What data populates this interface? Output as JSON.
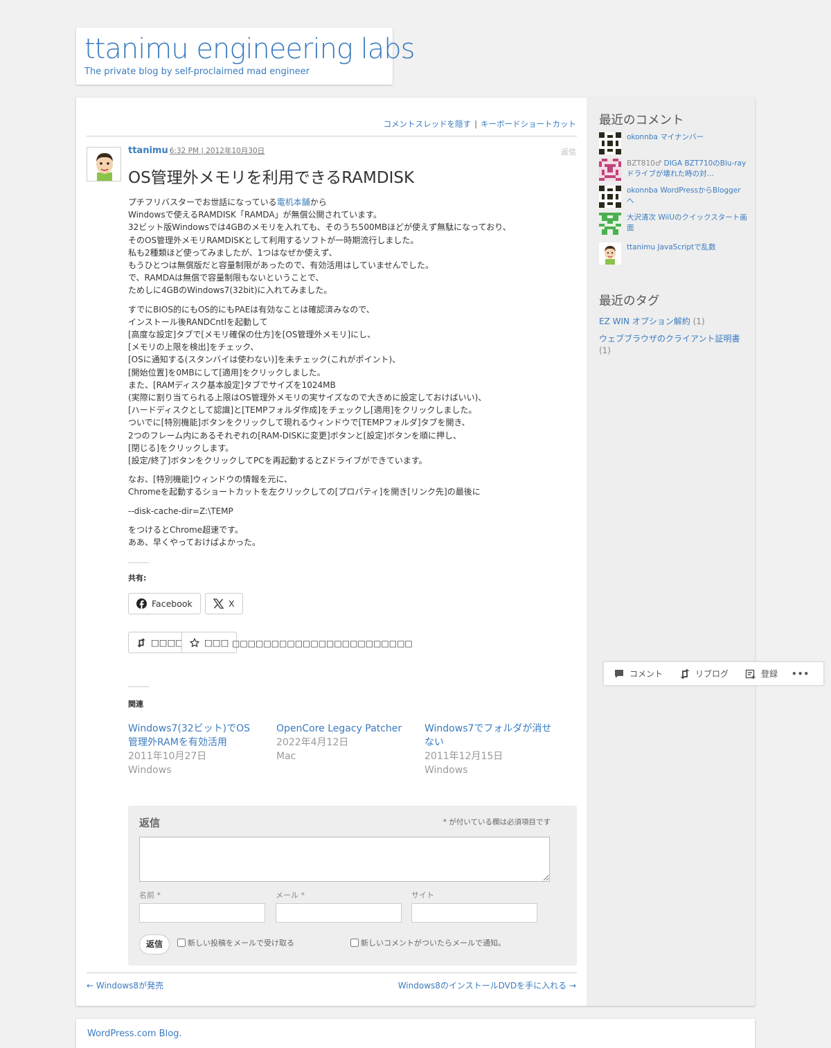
{
  "site": {
    "title": "ttanimu engineering labs",
    "tagline": "The private blog by self-proclaimed mad engineer"
  },
  "thread_links": {
    "hide": "コメントスレッドを隠す",
    "separator": "|",
    "shortcuts": "キーボードショートカット"
  },
  "post": {
    "author": "ttanimu",
    "datetime": "6:32 PM | 2012年10月30日",
    "reply": "返信",
    "title": "OS管理外メモリを利用できるRAMDISK",
    "p1_pre": "プチフリバスターでお世話になっている",
    "p1_link": "電机本舗",
    "p1_post": "から\nWindowsで使えるRAMDISK「RAMDA」が無償公開されています。\n32ビット版Windowsでは4GBのメモリを入れても、そのうち500MBほどが使えず無駄になっており、\nそのOS管理外メモリRAMDISKとして利用するソフトが一時期流行しました。\n私も2種類ほど使ってみましたが、1つはなぜか使えず、\nもうひとつは無償版だと容量制限があったので、有効活用はしていませんでした。\nで、RAMDAは無償で容量制限もないということで、\nためしに4GBのWindows7(32bit)に入れてみました。",
    "p2": "すでにBIOS的にもOS的にもPAEは有効なことは確認済みなので、\nインストール後RANDCntlを起動して\n[高度な設定]タブで[メモリ確保の仕方]を[OS管理外メモリ]にし、\n[メモリの上限を検出]をチェック、\n[OSに通知する(スタンバイは使わない)]を未チェック(これがポイント)、\n[開始位置]を0MBにして[適用]をクリックしました。\nまた、[RAMディスク基本設定]タブでサイズを1024MB\n(実際に割り当てられる上限はOS管理外メモリの実サイズなので大きめに設定しておけばいい)、\n[ハードディスクとして認識]と[TEMPフォルダ作成]をチェックし[適用]をクリックしました。\nついでに[特別機能]ボタンをクリックして現れるウィンドウで[TEMPフォルダ]タブを開き、\n2つのフレーム内にあるそれぞれの[RAM-DISKに変更]ボタンと[設定]ボタンを順に押し、\n[閉じる]をクリックします。\n[設定/終了]ボタンをクリックしてPCを再起動するとZドライブができています。",
    "p3": "なお、[特別機能]ウィンドウの情報を元に、\nChromeを起動するショートカットを左クリックしての[プロパティ]を開き[リンク先]の最後に",
    "p4": "--disk-cache-dir=Z:\\TEMP",
    "p5": "をつけるとChrome超速です。\nああ、早くやっておけばよかった。"
  },
  "share": {
    "label": "共有:",
    "facebook": "Facebook",
    "x": "X"
  },
  "like": {
    "reblog": "□□□□",
    "like": "□□□",
    "text": "□□□□□□□□□□□□□□□□□□□□□□□"
  },
  "related": {
    "label": "関連",
    "items": [
      {
        "title": "Windows7(32ビット)でOS管理外RAMを有効活用",
        "date": "2011年10月27日",
        "cat": "Windows"
      },
      {
        "title": "OpenCore Legacy Patcher",
        "date": "2022年4月12日",
        "cat": "Mac"
      },
      {
        "title": "Windows7でフォルダが消せない",
        "date": "2011年12月15日",
        "cat": "Windows"
      }
    ]
  },
  "form": {
    "heading": "返信",
    "required_note": "* が付いている欄は必須項目です",
    "name_label": "名前 *",
    "email_label": "メール *",
    "site_label": "サイト",
    "submit": "返信",
    "chk_posts": "新しい投稿をメールで受け取る",
    "chk_comments": "新しいコメントがついたらメールで通知。"
  },
  "nav": {
    "prev": "← Windows8が発売",
    "next": "Windows8のインストールDVDを手に入れる →"
  },
  "sidebar": {
    "recent_comments_title": "最近のコメント",
    "comments": [
      {
        "author": "okonnba",
        "author_is_link": true,
        "text": "マイナンバー",
        "avatar": "identicon-black"
      },
      {
        "author": "BZT810♂",
        "author_is_link": false,
        "text": "DIGA BZT710のBlu-rayドライブが壊れた時の対…",
        "avatar": "identicon-pink"
      },
      {
        "author": "okonnba",
        "author_is_link": true,
        "text": "WordPressからBloggerへ",
        "avatar": "identicon-black"
      },
      {
        "author": "大沢清次",
        "author_is_link": true,
        "text": "WiiUのクイックスタート画面",
        "avatar": "identicon-green"
      },
      {
        "author": "ttanimu",
        "author_is_link": true,
        "text": "JavaScriptで乱数",
        "avatar": "mii-face"
      }
    ],
    "recent_tags_title": "最近のタグ",
    "tags": [
      {
        "name": "EZ WIN オプション解約",
        "count": "(1)"
      },
      {
        "name": "ウェブブラウザのクライアント証明書",
        "count": "(1)"
      }
    ]
  },
  "action_bar": {
    "comment": "コメント",
    "reblog": "リブログ",
    "subscribe": "登録",
    "more": "•••"
  },
  "footer": {
    "link": "WordPress.com Blog."
  },
  "colors": {
    "link": "#3a7bc0",
    "background": "#f1f1f1",
    "sidebar": "#eeeeee"
  }
}
